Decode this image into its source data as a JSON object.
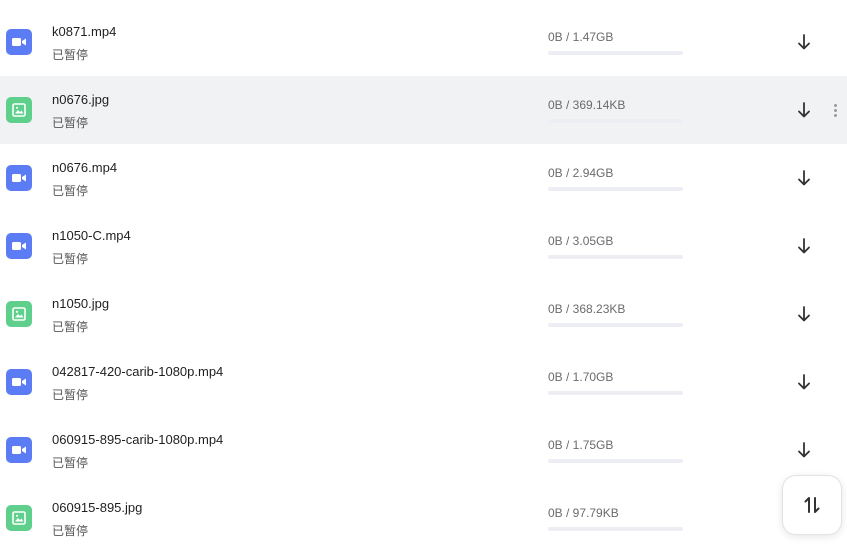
{
  "downloads": [
    {
      "name": "k0871.mp4",
      "status": "已暂停",
      "size": "0B / 1.47GB",
      "type": "video",
      "icon": "video-file-icon",
      "progress": 0
    },
    {
      "name": "n0676.jpg",
      "status": "已暂停",
      "size": "0B / 369.14KB",
      "type": "image",
      "icon": "image-file-icon",
      "progress": 0,
      "hovered": true
    },
    {
      "name": "n0676.mp4",
      "status": "已暂停",
      "size": "0B / 2.94GB",
      "type": "video",
      "icon": "video-file-icon",
      "progress": 0
    },
    {
      "name": "n1050-C.mp4",
      "status": "已暂停",
      "size": "0B / 3.05GB",
      "type": "video",
      "icon": "video-file-icon",
      "progress": 0
    },
    {
      "name": "n1050.jpg",
      "status": "已暂停",
      "size": "0B / 368.23KB",
      "type": "image",
      "icon": "image-file-icon",
      "progress": 0
    },
    {
      "name": "042817-420-carib-1080p.mp4",
      "status": "已暂停",
      "size": "0B / 1.70GB",
      "type": "video",
      "icon": "video-file-icon",
      "progress": 0
    },
    {
      "name": "060915-895-carib-1080p.mp4",
      "status": "已暂停",
      "size": "0B / 1.75GB",
      "type": "video",
      "icon": "video-file-icon",
      "progress": 0
    },
    {
      "name": "060915-895.jpg",
      "status": "已暂停",
      "size": "0B / 97.79KB",
      "type": "image",
      "icon": "image-file-icon",
      "progress": 0
    }
  ],
  "row_actions": {
    "download_icon": "download-arrow-icon",
    "more_icon": "more-vertical-icon"
  },
  "sort_button": {
    "icon": "sort-arrows-icon"
  },
  "colors": {
    "video_icon_bg": "#5b7cf5",
    "image_icon_bg": "#5fcf8c",
    "hover_row_bg": "#f1f2f4",
    "progress_track": "#eceef4"
  }
}
